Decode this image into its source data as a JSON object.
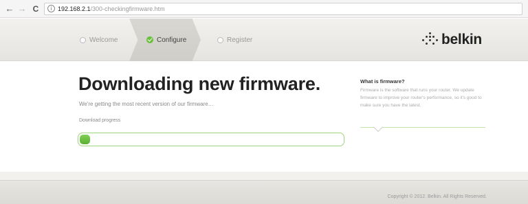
{
  "browser": {
    "back_icon": "arrow-left-icon",
    "forward_icon": "arrow-right-icon",
    "reload_label": "C",
    "url_host": "192.168.2.1",
    "url_path": "/300-checkingfirmware.htm"
  },
  "steps": [
    {
      "label": "Welcome",
      "state": "inactive"
    },
    {
      "label": "Configure",
      "state": "active"
    },
    {
      "label": "Register",
      "state": "inactive"
    }
  ],
  "logo": {
    "text": "belkin"
  },
  "main": {
    "title": "Downloading new firmware.",
    "subtitle": "We're getting the most recent version of our firmware…",
    "progress_label": "Download progress",
    "progress_fraction": 0.04
  },
  "side": {
    "title": "What is firmware?",
    "text": "Firmware is the software that runs your router. We update firmware to improve your router's performance, so it's good to make sure you have the latest."
  },
  "footer": {
    "copyright": "Copyright © 2012. Belkin. All Rights Reserved."
  },
  "colors": {
    "accent_green": "#6abf3d",
    "progress_border": "#9fd37e"
  }
}
